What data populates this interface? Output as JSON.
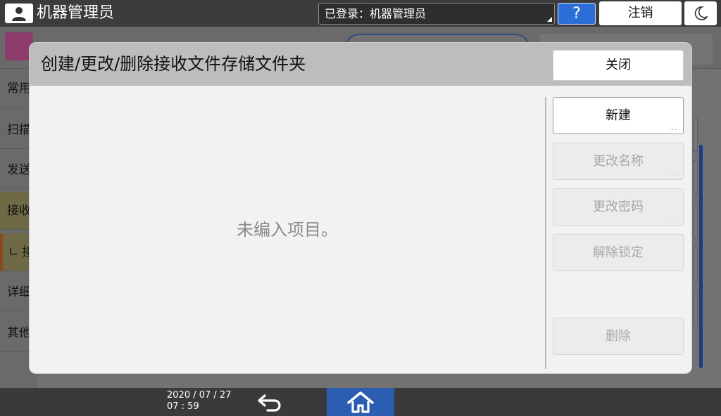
{
  "topbar": {
    "user_title": "机器管理员",
    "login_status": "已登录：机器管理员",
    "help_label": "?",
    "logout_label": "注销"
  },
  "background": {
    "sidebar_items": [
      "常用",
      "扫描",
      "发送",
      "接收",
      "∟ 接",
      "详细",
      "其他"
    ]
  },
  "dialog": {
    "title": "创建/更改/删除接收文件存储文件夹",
    "close_label": "关闭",
    "empty_message": "未编入项目。",
    "buttons": [
      {
        "label": "新建",
        "enabled": true,
        "has_more": true
      },
      {
        "label": "更改名称",
        "enabled": false,
        "has_more": true
      },
      {
        "label": "更改密码",
        "enabled": false,
        "has_more": true
      },
      {
        "label": "解除锁定",
        "enabled": false,
        "has_more": false
      },
      {
        "label": "删除",
        "enabled": false,
        "has_more": false
      }
    ],
    "more_indicator": "..."
  },
  "bottombar": {
    "date": "2020 / 07 / 27",
    "time": "07 : 59"
  },
  "colors": {
    "accent_blue": "#2c6fd8",
    "home_blue": "#2b5db0",
    "dialog_bg": "#f2f2f4",
    "dialog_header": "#bdbdbd"
  }
}
